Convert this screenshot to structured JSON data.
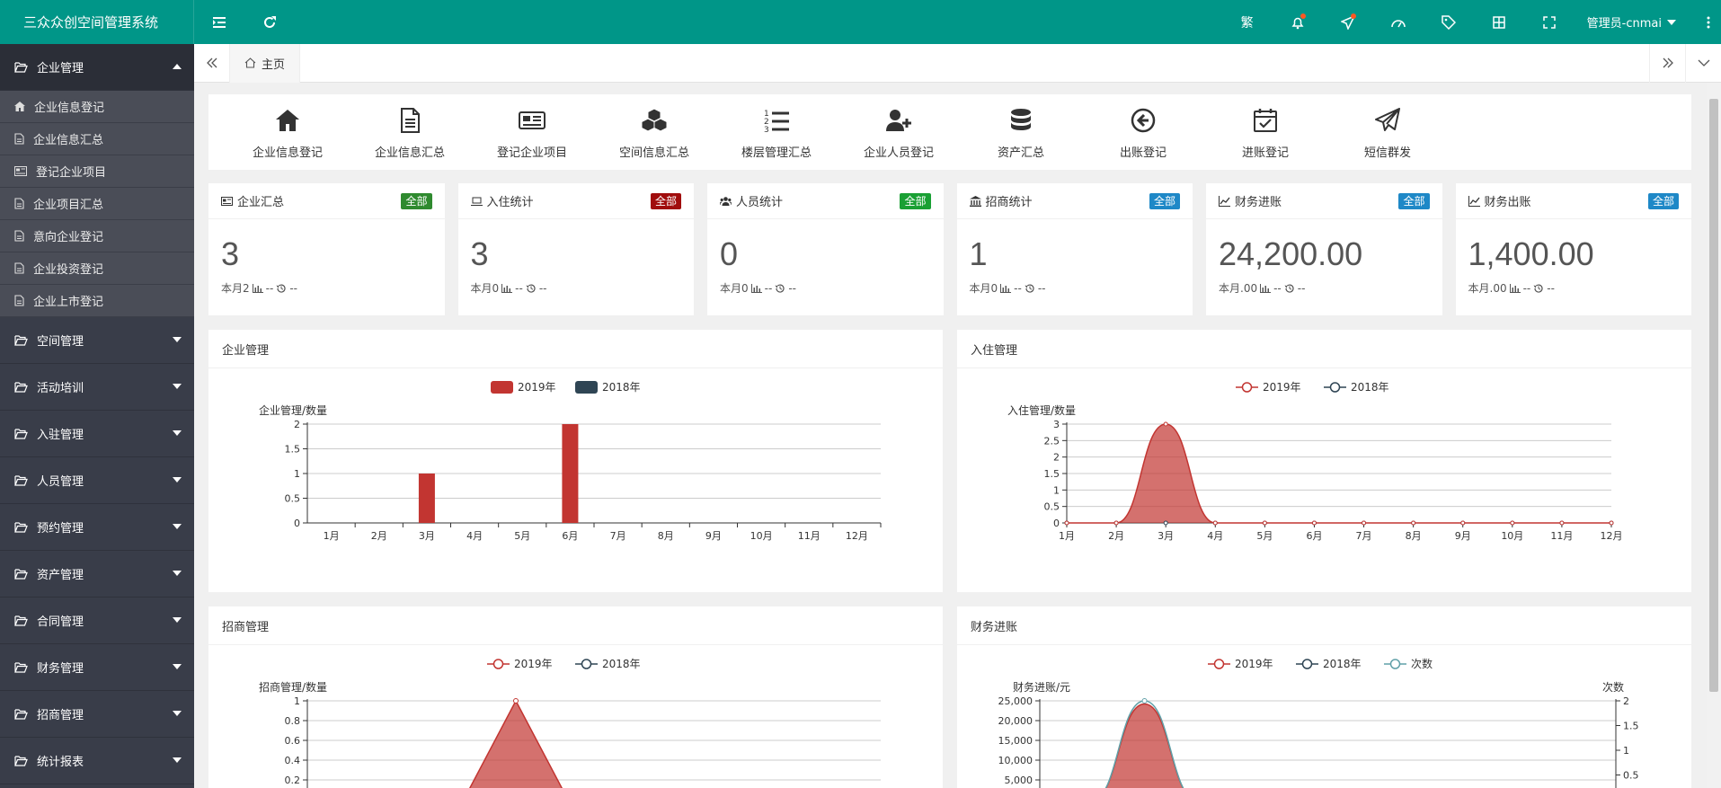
{
  "app": {
    "title": "三众众创空间管理系统",
    "user": "管理员-cnmai"
  },
  "sidebar": {
    "groups": [
      {
        "label": "企业管理",
        "open": true,
        "items": [
          "企业信息登记",
          "企业信息汇总",
          "登记企业项目",
          "企业项目汇总",
          "意向企业登记",
          "企业投资登记",
          "企业上市登记"
        ]
      },
      {
        "label": "空间管理"
      },
      {
        "label": "活动培训"
      },
      {
        "label": "入驻管理"
      },
      {
        "label": "人员管理"
      },
      {
        "label": "预约管理"
      },
      {
        "label": "资产管理"
      },
      {
        "label": "合同管理"
      },
      {
        "label": "财务管理"
      },
      {
        "label": "招商管理"
      },
      {
        "label": "统计报表"
      }
    ]
  },
  "tabs": {
    "home": "主页"
  },
  "shortcuts": [
    {
      "label": "企业信息登记",
      "icon": "home-icon"
    },
    {
      "label": "企业信息汇总",
      "icon": "document-icon"
    },
    {
      "label": "登记企业项目",
      "icon": "newspaper-icon"
    },
    {
      "label": "空间信息汇总",
      "icon": "cubes-icon"
    },
    {
      "label": "楼层管理汇总",
      "icon": "ordered-list-icon"
    },
    {
      "label": "企业人员登记",
      "icon": "user-plus-icon"
    },
    {
      "label": "资产汇总",
      "icon": "database-icon"
    },
    {
      "label": "出账登记",
      "icon": "arrow-circle-left-icon"
    },
    {
      "label": "进账登记",
      "icon": "calendar-check-icon"
    },
    {
      "label": "短信群发",
      "icon": "paper-plane-icon"
    }
  ],
  "stats": [
    {
      "title": "企业汇总",
      "badge": "全部",
      "badge_color": "#2f8a2f",
      "value": "3",
      "foot": "本月2",
      "foot_suffix": "--"
    },
    {
      "title": "入住统计",
      "badge": "全部",
      "badge_color": "#a10d0d",
      "value": "3",
      "foot": "本月0",
      "foot_suffix": "--"
    },
    {
      "title": "人员统计",
      "badge": "全部",
      "badge_color": "#1aa034",
      "value": "0",
      "foot": "本月0",
      "foot_suffix": "--"
    },
    {
      "title": "招商统计",
      "badge": "全部",
      "badge_color": "#1e88c7",
      "value": "1",
      "foot": "本月0",
      "foot_suffix": "--"
    },
    {
      "title": "财务进账",
      "badge": "全部",
      "badge_color": "#1e88c7",
      "value": "24,200.00",
      "foot": "本月.00",
      "foot_suffix": "--"
    },
    {
      "title": "财务出账",
      "badge": "全部",
      "badge_color": "#1e88c7",
      "value": "1,400.00",
      "foot": "本月.00",
      "foot_suffix": "--"
    }
  ],
  "panels": {
    "p1": "企业管理",
    "p2": "入住管理",
    "p3": "招商管理",
    "p4": "财务进账"
  },
  "colors": {
    "red": "#c23531",
    "dark": "#2f4554",
    "teal": "#61a0a8",
    "topbar": "#009688"
  },
  "chart_data": [
    {
      "type": "bar",
      "title": "企业管理",
      "ylabel": "企业管理/数量",
      "categories": [
        "1月",
        "2月",
        "3月",
        "4月",
        "5月",
        "6月",
        "7月",
        "8月",
        "9月",
        "10月",
        "11月",
        "12月"
      ],
      "ylim": [
        0,
        2
      ],
      "yticks": [
        "0",
        "0.5",
        "1",
        "1.5",
        "2"
      ],
      "legend": "top-center",
      "series": [
        {
          "name": "2019年",
          "values": [
            0,
            0,
            1,
            0,
            0,
            2,
            0,
            0,
            0,
            0,
            0,
            0
          ]
        },
        {
          "name": "2018年",
          "values": [
            0,
            0,
            0,
            0,
            0,
            0,
            0,
            0,
            0,
            0,
            0,
            0
          ]
        }
      ]
    },
    {
      "type": "area",
      "title": "入住管理",
      "ylabel": "入住管理/数量",
      "categories": [
        "1月",
        "2月",
        "3月",
        "4月",
        "5月",
        "6月",
        "7月",
        "8月",
        "9月",
        "10月",
        "11月",
        "12月"
      ],
      "ylim": [
        0,
        3
      ],
      "yticks": [
        "0",
        "0.5",
        "1",
        "1.5",
        "2",
        "2.5",
        "3"
      ],
      "legend": "top-center",
      "series": [
        {
          "name": "2019年",
          "values": [
            0,
            0,
            3,
            0,
            0,
            0,
            0,
            0,
            0,
            0,
            0,
            0
          ]
        },
        {
          "name": "2018年",
          "values": [
            0,
            0,
            0,
            0,
            0,
            0,
            0,
            0,
            0,
            0,
            0,
            0
          ]
        }
      ]
    },
    {
      "type": "area",
      "title": "招商管理",
      "ylabel": "招商管理/数量",
      "categories": [
        "1月",
        "2月",
        "3月",
        "4月",
        "5月",
        "6月",
        "7月",
        "8月",
        "9月",
        "10月",
        "11月",
        "12月"
      ],
      "ylim": [
        0,
        1
      ],
      "yticks": [
        "0.2",
        "0.4",
        "0.6",
        "0.8",
        "1"
      ],
      "legend": "top-center",
      "series": [
        {
          "name": "2019年",
          "values": [
            0,
            0,
            0,
            0,
            1,
            0,
            0,
            0,
            0,
            0,
            0,
            0
          ]
        },
        {
          "name": "2018年",
          "values": [
            0,
            0,
            0,
            0,
            0,
            0,
            0,
            0,
            0,
            0,
            0,
            0
          ]
        }
      ]
    },
    {
      "type": "area",
      "title": "财务进账",
      "ylabel": "财务进账/元",
      "ylabel_right": "次数",
      "ylim": [
        0,
        25000
      ],
      "yticks": [
        "5,000",
        "10,000",
        "15,000",
        "20,000",
        "25,000"
      ],
      "yticks_right": [
        "0.5",
        "1",
        "1.5",
        "2"
      ],
      "legend": "top-center",
      "series": [
        {
          "name": "2019年",
          "values": [
            0,
            0,
            24200,
            0,
            0,
            0,
            0,
            0,
            0,
            0,
            0,
            0
          ]
        },
        {
          "name": "2018年",
          "values": [
            0,
            0,
            0,
            0,
            0,
            0,
            0,
            0,
            0,
            0,
            0,
            0
          ]
        },
        {
          "name": "次数",
          "values": [
            0,
            0,
            2,
            0,
            0,
            0,
            0,
            0,
            0,
            0,
            0,
            0
          ]
        }
      ]
    }
  ]
}
